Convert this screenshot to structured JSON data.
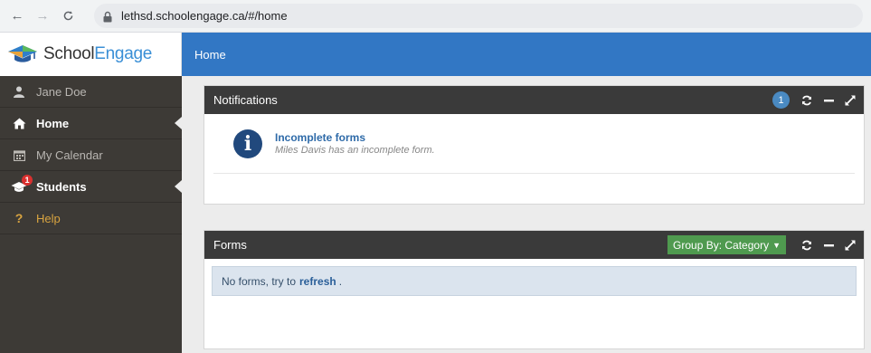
{
  "browser": {
    "back": "←",
    "forward": "→",
    "reload": "C",
    "url": "lethsd.schoolengage.ca/#/home"
  },
  "brand": {
    "name_part1": "School",
    "name_part2": "Engage"
  },
  "topbar": {
    "title": "Home"
  },
  "sidebar": {
    "items": [
      {
        "label": "Jane Doe",
        "icon": "user-icon"
      },
      {
        "label": "Home",
        "icon": "home-icon"
      },
      {
        "label": "My Calendar",
        "icon": "calendar-icon"
      },
      {
        "label": "Students",
        "icon": "graduation-cap-icon",
        "badge": "1"
      },
      {
        "label": "Help",
        "icon": "question-icon",
        "glyph": "?"
      }
    ]
  },
  "notifications": {
    "title": "Notifications",
    "count": "1",
    "items": [
      {
        "title": "Incomplete forms",
        "subtitle": "Miles Davis has an incomplete form."
      }
    ]
  },
  "forms": {
    "title": "Forms",
    "group_by": "Group By: Category",
    "empty_text": "No forms, try to",
    "refresh_link": "refresh",
    "period": "."
  },
  "colors": {
    "topbar": "#3277c4",
    "sidebar": "#3d3a36",
    "panel_header": "#3a3a3a",
    "group_button": "#4f9a4f",
    "badge_red": "#d9302f",
    "help": "#d9a440"
  }
}
